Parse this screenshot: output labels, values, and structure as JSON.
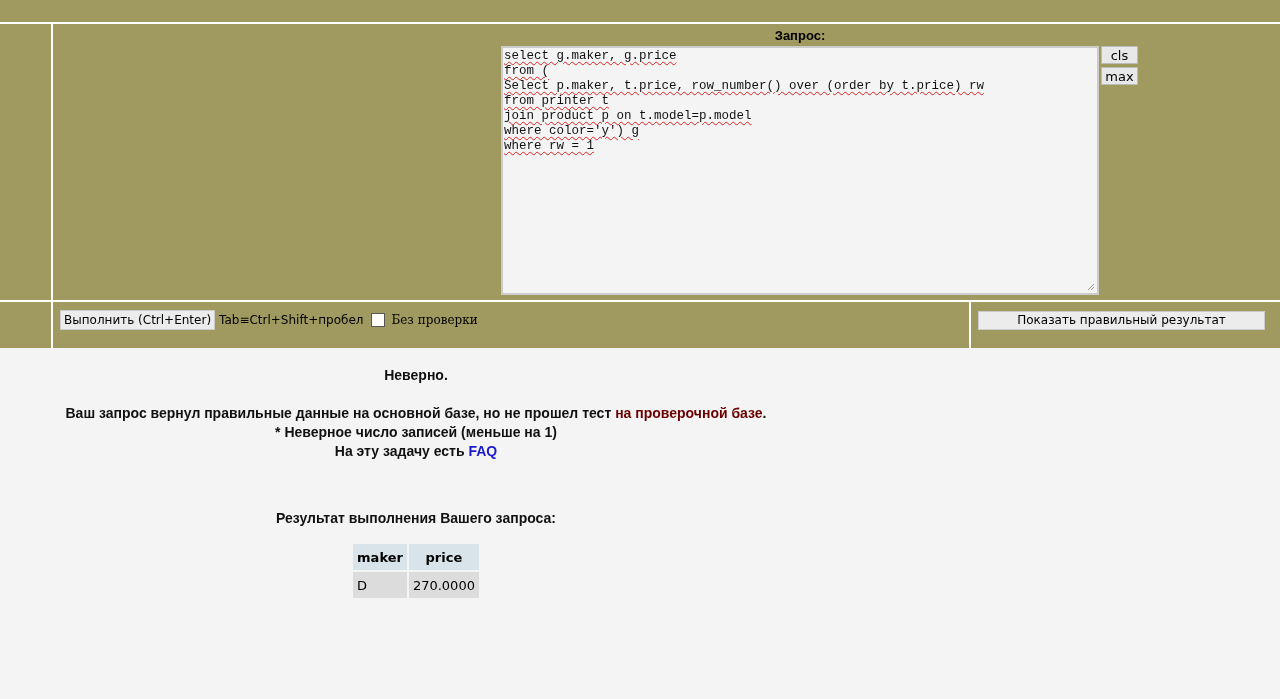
{
  "query_label": "Запрос:",
  "query_lines": [
    "select g.maker, g.price",
    "from (",
    "Select p.maker, t.price, row_number() over (order by t.price) rw",
    "from printer t",
    "join product p on t.model=p.model",
    "where color='y') g",
    "where rw = 1"
  ],
  "side_buttons": [
    "cls",
    "max"
  ],
  "run_button": "Выполнить (Ctrl+Enter)",
  "hint": "Tab≡Ctrl+Shift+пробел",
  "checkbox": {
    "label": "Без проверки",
    "checked": false
  },
  "show_result_button": "Показать правильный результат",
  "verdict": "Неверно.",
  "message": {
    "text": "Ваш запрос вернул правильные данные на основной базе, но не прошел тест",
    "link": "на проверочной базе",
    "end": "."
  },
  "detail": "* Неверное число записей (меньше на 1)",
  "faq": {
    "text": "На эту задачу есть",
    "link": "FAQ"
  },
  "result_title": "Результат выполнения Вашего запроса:",
  "table": {
    "columns": [
      "maker",
      "price"
    ],
    "rows": [
      [
        "D",
        "270.0000"
      ]
    ]
  }
}
